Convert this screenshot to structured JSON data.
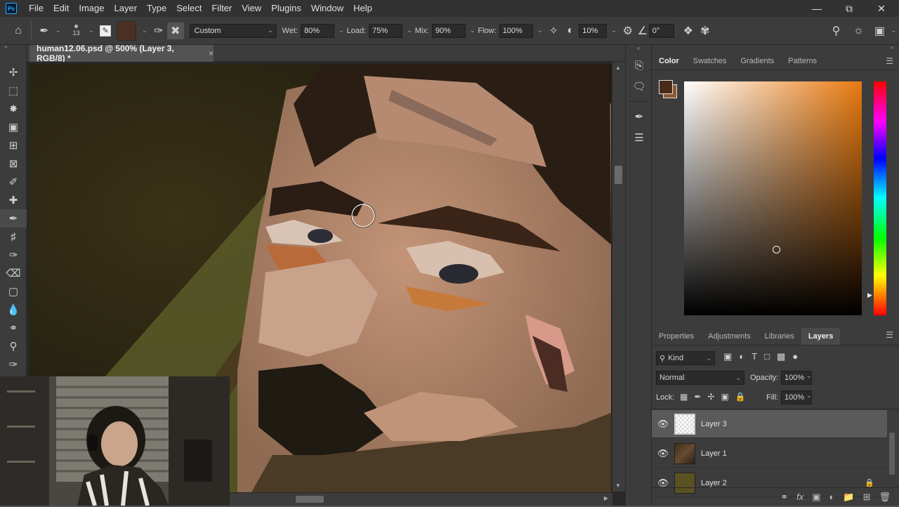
{
  "menubar": {
    "logo": "Ps",
    "items": [
      "File",
      "Edit",
      "Image",
      "Layer",
      "Type",
      "Select",
      "Filter",
      "View",
      "Plugins",
      "Window",
      "Help"
    ]
  },
  "options": {
    "brush_size": "13",
    "brush_preset": "Custom",
    "wet_label": "Wet:",
    "wet_value": "80%",
    "load_label": "Load:",
    "load_value": "75%",
    "mix_label": "Mix:",
    "mix_value": "90%",
    "flow_label": "Flow:",
    "flow_value": "100%",
    "smoothing_value": "10%",
    "angle_value": "0°"
  },
  "document": {
    "tab_title": "human12.06.psd @ 500% (Layer 3, RGB/8) *"
  },
  "color_panel": {
    "tabs": [
      "Color",
      "Swatches",
      "Gradients",
      "Patterns"
    ],
    "active_tab": "Color",
    "foreground": "#4a2a1a",
    "background": "#8a5a30",
    "hue_color": "#e87a10"
  },
  "layers_panel": {
    "tabs": [
      "Properties",
      "Adjustments",
      "Libraries",
      "Layers"
    ],
    "active_tab": "Layers",
    "filter_label": "Kind",
    "blend_mode": "Normal",
    "opacity_label": "Opacity:",
    "opacity_value": "100%",
    "lock_label": "Lock:",
    "fill_label": "Fill:",
    "fill_value": "100%",
    "layers": [
      {
        "name": "Layer 3",
        "selected": true
      },
      {
        "name": "Layer 1",
        "selected": false
      },
      {
        "name": "Layer 2",
        "selected": false
      }
    ]
  }
}
